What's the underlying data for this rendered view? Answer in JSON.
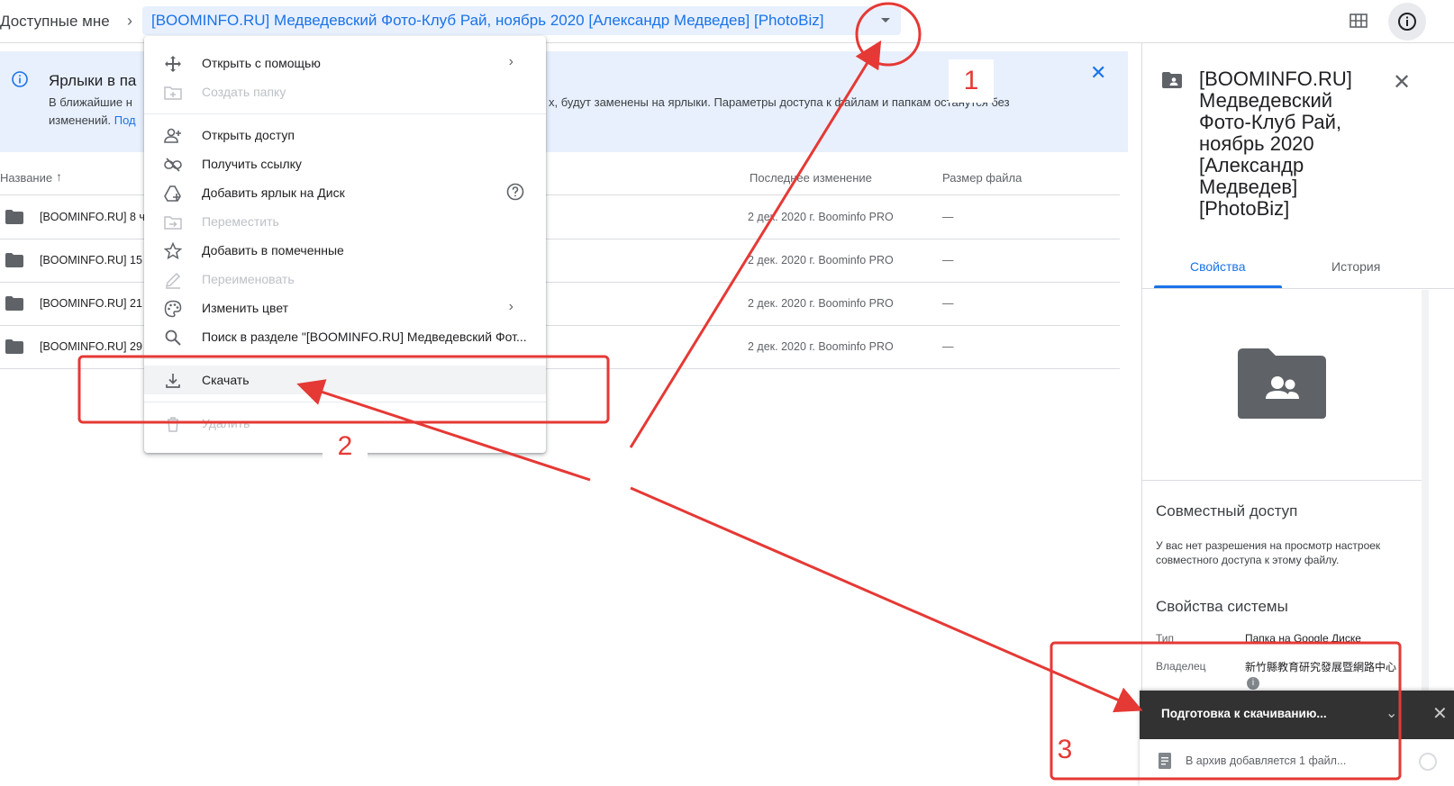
{
  "header": {
    "breadcrumb_root": "Доступные мне",
    "breadcrumb_current": "[BOOMINFO.RU] Медведевский Фото-Клуб Рай, ноябрь 2020 [Александр Медведев] [PhotoBiz]"
  },
  "banner": {
    "title": "Ярлыки в па",
    "text_line1_a": "В ближайшие н",
    "text_line1_b": "х, будут заменены на ярлыки. Параметры доступа к файлам и папкам останутся без",
    "text_line2": "изменений.",
    "link": "Под"
  },
  "list": {
    "col_name": "Название",
    "col_modified": "Последнее изменение",
    "col_size": "Размер файла",
    "rows": [
      {
        "name": "[BOOMINFO.RU] 8 ч",
        "date": "2 дек. 2020 г. Boominfo PRO",
        "size": "—"
      },
      {
        "name": "[BOOMINFO.RU] 15",
        "date": "2 дек. 2020 г. Boominfo PRO",
        "size": "—"
      },
      {
        "name": "[BOOMINFO.RU] 21",
        "date": "2 дек. 2020 г. Boominfo PRO",
        "size": "—"
      },
      {
        "name": "[BOOMINFO.RU] 29",
        "date": "2 дек. 2020 г. Boominfo PRO",
        "size": "—"
      }
    ]
  },
  "menu": {
    "open_with": "Открыть с помощью",
    "create_folder": "Создать папку",
    "share": "Открыть доступ",
    "get_link": "Получить ссылку",
    "add_shortcut": "Добавить ярлык на Диск",
    "move": "Переместить",
    "add_starred": "Добавить в помеченные",
    "rename": "Переименовать",
    "change_color": "Изменить цвет",
    "search_in": "Поиск в разделе \"[BOOMINFO.RU] Медведевский Фот...",
    "download": "Скачать",
    "delete": "Удалить"
  },
  "panel": {
    "title": "[BOOMINFO.RU] Медведевский Фото-Клуб Рай, ноябрь 2020 [Александр Медведев] [PhotoBiz]",
    "tab_properties": "Свойства",
    "tab_history": "История",
    "sharing_title": "Совместный доступ",
    "sharing_text": "У вас нет разрешения на просмотр настроек совместного доступа к этому файлу.",
    "system_title": "Свойства системы",
    "type_key": "Тип",
    "type_value": "Папка на Google Диске",
    "owner_key": "Владелец",
    "owner_value": "新竹縣教育研究發展暨網路中心"
  },
  "toast": {
    "title": "Подготовка к скачиванию...",
    "status": "В архив добавляется 1 файл..."
  },
  "annotations": {
    "n1": "1",
    "n2": "2",
    "n3": "3",
    "color": "#e53935"
  },
  "colors": {
    "accent": "#1a73e8",
    "banner_bg": "#e8f0fe",
    "toast_bg": "#323232"
  }
}
